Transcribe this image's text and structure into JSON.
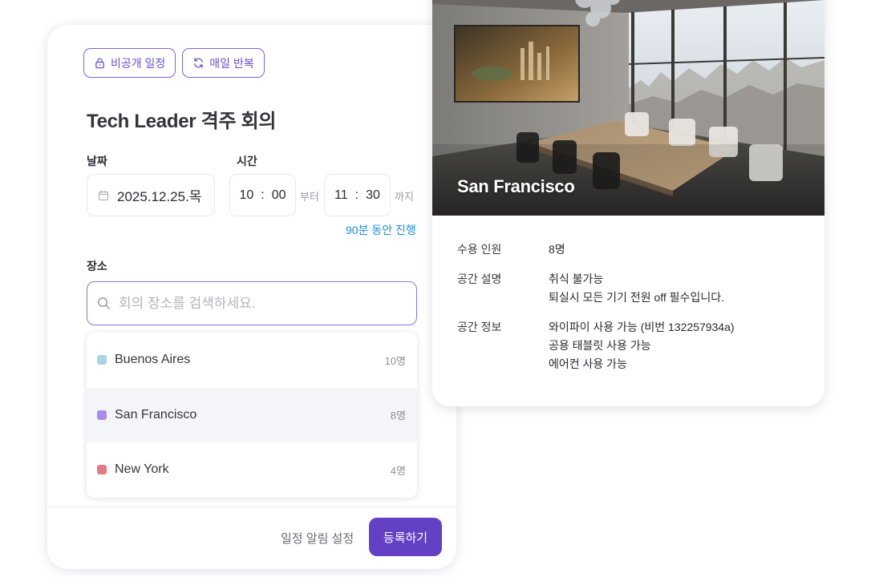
{
  "form": {
    "badges": {
      "private": "비공개 일정",
      "repeat": "매일 반복"
    },
    "title": "Tech Leader 격주 회의",
    "date_label": "날짜",
    "date_value": "2025.12.25.목",
    "time_label": "시간",
    "start_hour": "10",
    "start_minute": "00",
    "from_suffix": "부터",
    "end_hour": "11",
    "end_minute": "30",
    "to_suffix": "까지",
    "time_sep": ":",
    "duration_note": "90분 동안 진행",
    "place_label": "장소",
    "search_placeholder": "회의 장소를 검색하세요.",
    "locations": [
      {
        "name": "Buenos Aires",
        "capacity": "10명",
        "color": "#a9d4e3"
      },
      {
        "name": "San Francisco",
        "capacity": "8명",
        "color": "#a98af0"
      },
      {
        "name": "New York",
        "capacity": "4명",
        "color": "#e27b84"
      }
    ],
    "notify_label": "일정 알림 설정",
    "submit_label": "등록하기",
    "accent_color": "#6441c4"
  },
  "room": {
    "name": "San Francisco",
    "capacity_label": "수용 인원",
    "capacity_value": "8명",
    "desc_label": "공간 설명",
    "desc_lines": [
      "취식 불가능",
      "퇴실시 모든 기기 전원 off 필수입니다."
    ],
    "info_label": "공간 정보",
    "info_lines": [
      "와이파이 사용 가능 (비번 132257934a)",
      "공용 태블릿 사용 가능",
      "에어컨 사용 가능"
    ]
  }
}
